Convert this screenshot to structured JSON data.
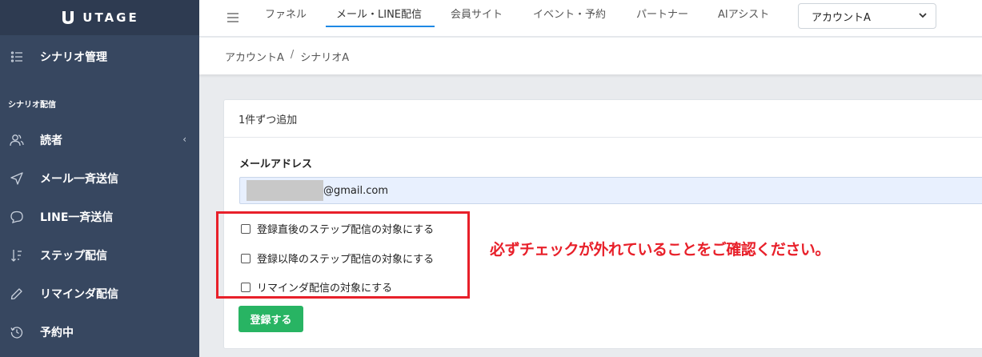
{
  "brand": {
    "name": "UTAGE"
  },
  "sidebar": {
    "section_label": "シナリオ配信",
    "items": [
      {
        "label": "シナリオ管理",
        "icon": "list-icon"
      },
      {
        "label": "読者",
        "icon": "users-icon"
      },
      {
        "label": "メール一斉送信",
        "icon": "send-icon"
      },
      {
        "label": "LINE一斉送信",
        "icon": "chat-icon"
      },
      {
        "label": "ステップ配信",
        "icon": "sort-icon"
      },
      {
        "label": "リマインダ配信",
        "icon": "pencil-icon"
      },
      {
        "label": "予約中",
        "icon": "history-icon"
      }
    ]
  },
  "topnav": {
    "tabs": [
      {
        "label": "ファネル"
      },
      {
        "label": "メール・LINE配信",
        "active": true
      },
      {
        "label": "会員サイト"
      },
      {
        "label": "イベント・予約"
      },
      {
        "label": "パートナー"
      },
      {
        "label": "AIアシスト"
      }
    ],
    "account_select": "アカウントA"
  },
  "breadcrumb": {
    "items": [
      "アカウントA",
      "シナリオA"
    ],
    "separator": "/"
  },
  "card": {
    "title": "1件ずつ追加",
    "email_label": "メールアドレス",
    "email_suffix": "@gmail.com",
    "checkboxes": [
      {
        "label": "登録直後のステップ配信の対象にする",
        "checked": false
      },
      {
        "label": "登録以降のステップ配信の対象にする",
        "checked": false
      },
      {
        "label": "リマインダ配信の対象にする",
        "checked": false
      }
    ],
    "submit_label": "登録する"
  },
  "annotation": {
    "text": "必ずチェックが外れていることをご確認ください。"
  },
  "colors": {
    "sidebar_bg": "#374760",
    "accent_blue": "#1e88e5",
    "submit_green": "#28b463",
    "annotation_red": "#e8202a"
  }
}
